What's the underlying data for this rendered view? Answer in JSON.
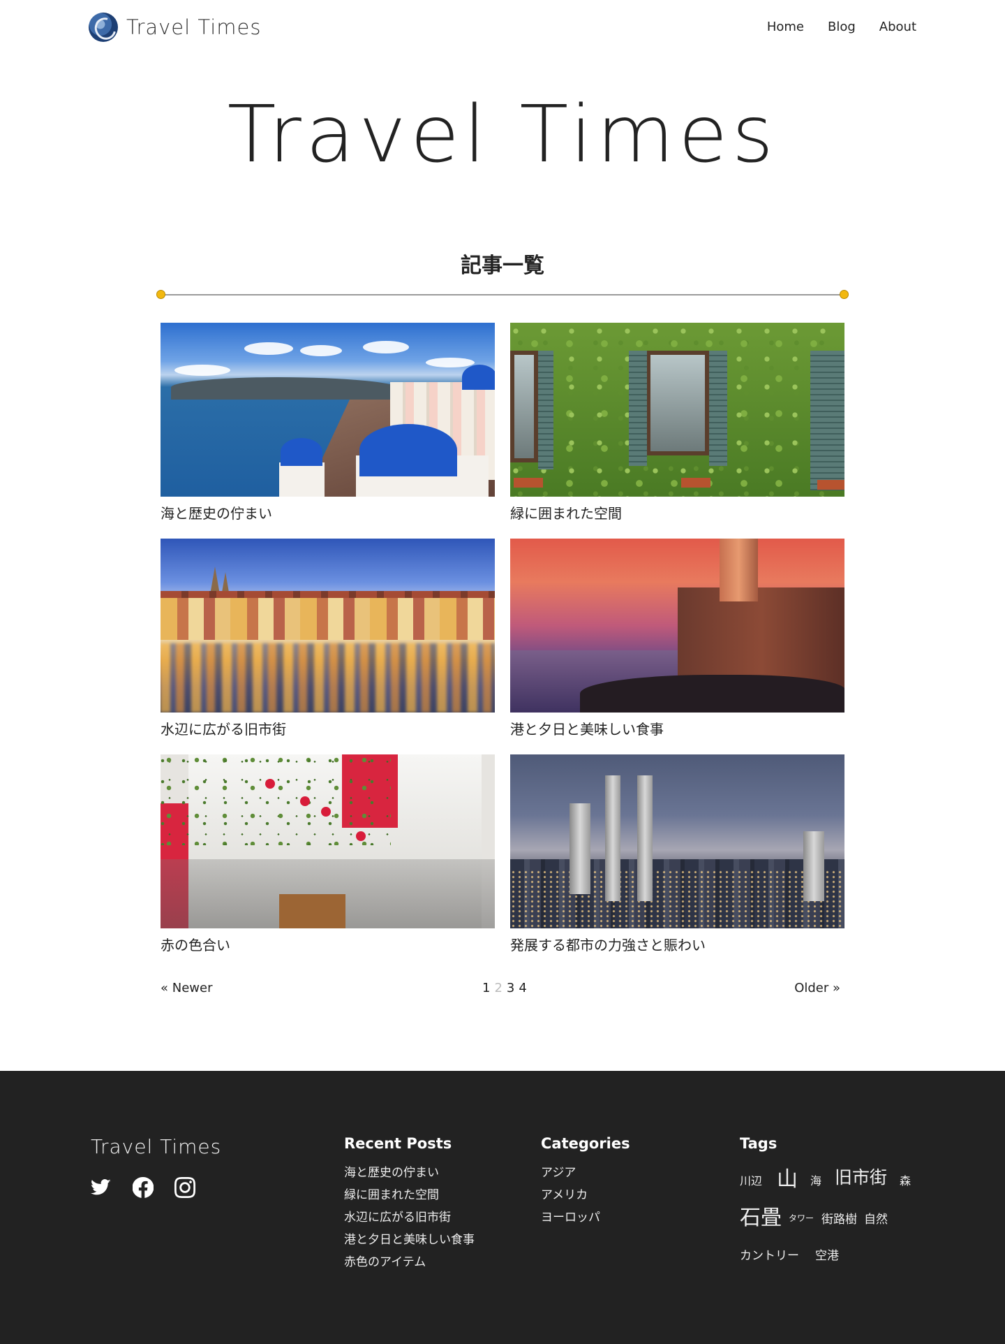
{
  "header": {
    "logo_text": "Travel Times",
    "nav": [
      "Home",
      "Blog",
      "About"
    ]
  },
  "hero": {
    "title": "Travel Times"
  },
  "section": {
    "title": "記事一覧"
  },
  "posts": [
    {
      "title": "海と歴史の佇まい"
    },
    {
      "title": "緑に囲まれた空間"
    },
    {
      "title": "水辺に広がる旧市街"
    },
    {
      "title": "港と夕日と美味しい食事"
    },
    {
      "title": "赤の色合い"
    },
    {
      "title": "発展する都市の力強さと賑わい"
    }
  ],
  "pagination": {
    "newer": "« Newer",
    "older": "Older »",
    "pages": [
      "1",
      "2",
      "3",
      "4"
    ],
    "current": "2"
  },
  "footer": {
    "logo_text": "Travel Times",
    "social_icons": [
      "twitter-icon",
      "facebook-icon",
      "instagram-icon"
    ],
    "recent_posts": {
      "heading": "Recent Posts",
      "items": [
        "海と歴史の佇まい",
        "緑に囲まれた空間",
        "水辺に広がる旧市街",
        "港と夕日と美味しい食事",
        "赤色のアイテム"
      ]
    },
    "categories": {
      "heading": "Categories",
      "items": [
        "アジア",
        "アメリカ",
        "ヨーロッパ"
      ]
    },
    "tags": {
      "heading": "Tags",
      "items": [
        "川辺",
        "山",
        "海",
        "旧市街",
        "森",
        "石畳",
        "タワー",
        "街路樹",
        "自然",
        "カントリー",
        "空港"
      ]
    }
  },
  "colors": {
    "accent_dot": "#f2b80f",
    "footer_bg": "#222222",
    "text": "#222222"
  }
}
